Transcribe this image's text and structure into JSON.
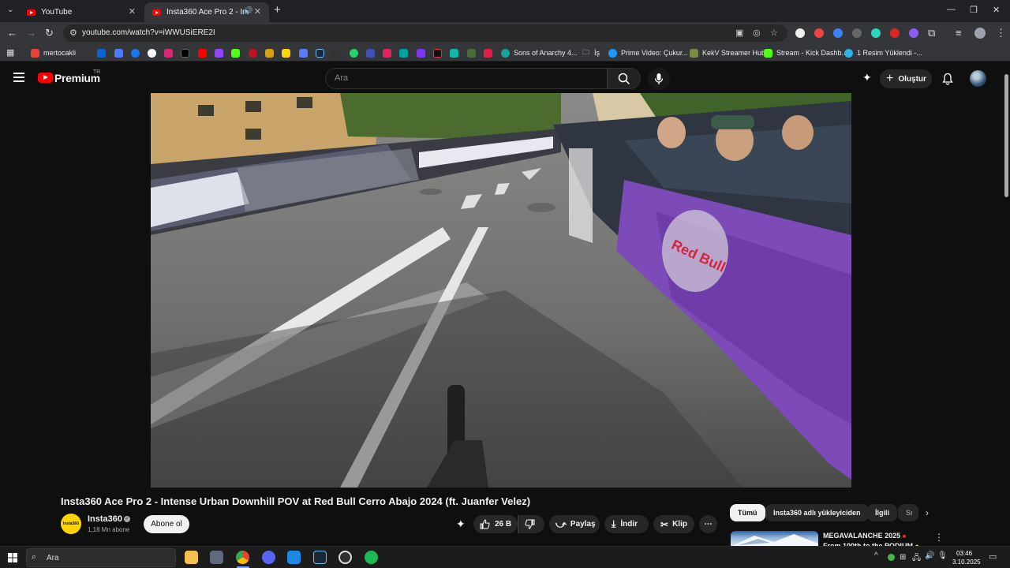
{
  "browser": {
    "tabs": [
      {
        "label": "YouTube",
        "active": false
      },
      {
        "label": "Insta360 Ace Pro 2 - Intens",
        "active": true
      }
    ],
    "url": "youtube.com/watch?v=iWWUSiERE2I",
    "bookmarks": [
      {
        "label": "mertocakli",
        "color": "#ea4335"
      },
      {
        "label": "Sons of Anarchy 4...",
        "color": "#1aa39a"
      },
      {
        "label": "İş",
        "color": "#9aa0a6"
      },
      {
        "label": "Prime Video: Çukur...",
        "color": "#1a98ff"
      },
      {
        "label": "KekV Streamer Hub",
        "color": "#7a8a4a"
      },
      {
        "label": "Stream - Kick Dashb...",
        "color": "#53fc18"
      },
      {
        "label": "1 Resim Yüklendi -...",
        "color": "#2bb3e6"
      }
    ]
  },
  "youtube": {
    "logo_text": "Premium",
    "country_code": "TR",
    "search_placeholder": "Ara",
    "create_label": "Oluştur"
  },
  "video": {
    "title": "Insta360 Ace Pro 2 - Intense Urban Downhill POV at Red Bull Cerro Abajo 2024 (ft. Juanfer Velez)",
    "banner_text": "Red Bull"
  },
  "channel": {
    "avatar_text": "Insta360",
    "name": "Insta360",
    "subscribers": "1,18 Mn abone",
    "subscribe_label": "Abone ol"
  },
  "actions": {
    "like_count": "26 B",
    "share_label": "Paylaş",
    "download_label": "İndir",
    "clip_label": "Klip",
    "more_label": "⋯"
  },
  "chips": [
    "Tümü",
    "Insta360 adlı yükleyiciden",
    "İlgili",
    "Sı"
  ],
  "recommendation": {
    "title_line1": "MEGAVALANCHE 2025",
    "title_line2": "From 100th to the PODIUM"
  },
  "taskbar": {
    "search_label": "Ara",
    "time": "03:46",
    "date": "3.10.2025"
  }
}
